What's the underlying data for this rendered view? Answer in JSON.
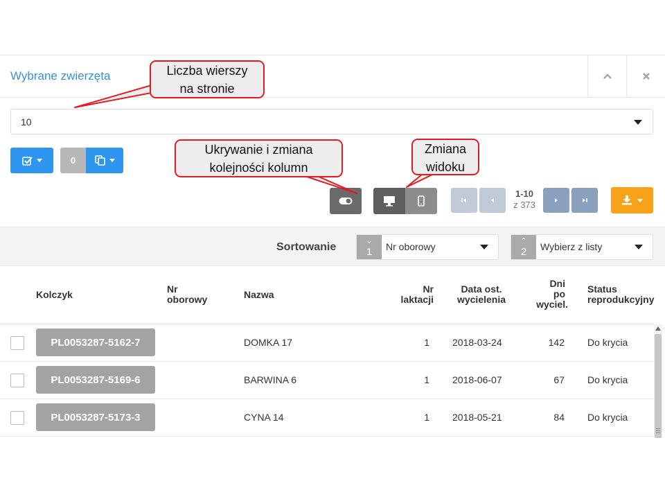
{
  "panel": {
    "title": "Wybrane zwierzęta"
  },
  "toolbar": {
    "rows_per_page_value": "10",
    "selected_count": "0",
    "pagination": {
      "range": "1-10",
      "total": "z 373"
    }
  },
  "sorting": {
    "label": "Sortowanie",
    "criteria": [
      {
        "index": "1",
        "value": "Nr oborowy"
      },
      {
        "index": "2",
        "value": "Wybierz z listy"
      }
    ]
  },
  "table": {
    "columns": [
      {
        "key": "kolczyk",
        "lines": [
          "Kolczyk"
        ]
      },
      {
        "key": "nr_oborowy",
        "lines": [
          "Nr",
          "oborowy"
        ]
      },
      {
        "key": "nazwa",
        "lines": [
          "Nazwa"
        ]
      },
      {
        "key": "nr_laktacji",
        "lines": [
          "Nr",
          "laktacji"
        ]
      },
      {
        "key": "data_wycielenia",
        "lines": [
          "Data ost.",
          "wycielenia"
        ]
      },
      {
        "key": "dni_po_wyc",
        "lines": [
          "Dni",
          "po",
          "wyciel."
        ]
      },
      {
        "key": "status",
        "lines": [
          "Status",
          "reprodukcyjny"
        ]
      }
    ],
    "rows": [
      {
        "kolczyk": "PL0053287-5162-7",
        "nr_oborowy": "",
        "nazwa": "DOMKA 17",
        "nr_laktacji": "1",
        "data": "2018-03-24",
        "dni": "142",
        "status": "Do krycia"
      },
      {
        "kolczyk": "PL0053287-5169-6",
        "nr_oborowy": "",
        "nazwa": "BARWINA 6",
        "nr_laktacji": "1",
        "data": "2018-06-07",
        "dni": "67",
        "status": "Do krycia"
      },
      {
        "kolczyk": "PL0053287-5173-3",
        "nr_oborowy": "",
        "nazwa": "CYNA 14",
        "nr_laktacji": "1",
        "data": "2018-05-21",
        "dni": "84",
        "status": "Do krycia"
      }
    ]
  },
  "callouts": {
    "rows_per_page": [
      "Liczba wierszy",
      "na stronie"
    ],
    "columns": [
      "Ukrywanie i zmiana",
      "kolejności kolumn"
    ],
    "view": [
      "Zmiana",
      "widoku"
    ]
  },
  "colors": {
    "accent": "#2e96f0",
    "title": "#3b8fd6",
    "export": "#f7a21b",
    "callout_border": "#e31c23",
    "tag_badge": "#a3a3a3"
  },
  "icons": {
    "collapse": "chevron-up-icon",
    "close": "close-icon",
    "select_all": "checkbox-icon",
    "copy": "copy-icon",
    "toggle_columns": "toggle-icon",
    "desktop_view": "monitor-icon",
    "mobile_view": "phone-icon",
    "export": "download-icon"
  }
}
